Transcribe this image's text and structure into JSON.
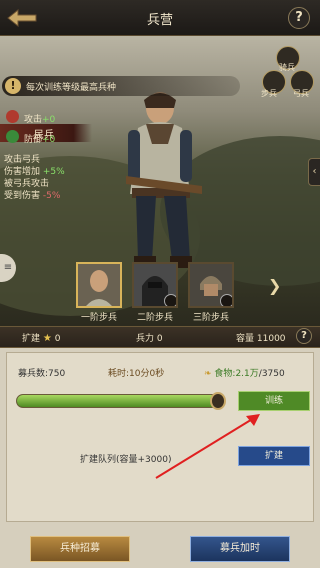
{
  "topbar": {
    "title": "兵营",
    "help": "?"
  },
  "banner": {
    "text": "每次训练等级最高兵种",
    "icon": "upgrade-icon"
  },
  "side": {
    "header": "民兵",
    "attack_label": "攻击",
    "attack_value": "+0",
    "defense_label": "防御",
    "defense_value": "+0",
    "desc": [
      {
        "text": "攻击弓兵",
        "value": ""
      },
      {
        "text": "伤害增加",
        "value": "+5%"
      },
      {
        "text": "被弓兵攻击",
        "value": ""
      },
      {
        "text": "受到伤害",
        "value": "-5%"
      }
    ]
  },
  "skills": {
    "top": "骑兵",
    "left": "步兵",
    "right": "弓兵"
  },
  "units": [
    {
      "label": "一阶步兵",
      "locked": false,
      "selected": true
    },
    {
      "label": "二阶步兵",
      "locked": true,
      "selected": false
    },
    {
      "label": "三阶步兵",
      "locked": true,
      "selected": false
    }
  ],
  "info": {
    "expand_label": "扩建",
    "expand_value": "0",
    "troops_label": "兵力",
    "troops_value": "0",
    "capacity_label": "容量",
    "capacity_value": "11000"
  },
  "panel": {
    "recruit_count": "募兵数:750",
    "time": "耗时:10分0秒",
    "food": "食物:2.1万",
    "food_extra": "/3750",
    "train_label": "训练",
    "expand_queue": "扩建队列(容量+3000)",
    "expand_button": "扩建",
    "progress_fraction": 0.97
  },
  "bottom": {
    "left": "兵种招募",
    "right": "募兵加时"
  },
  "colors": {
    "accent_green": "#4f8a26",
    "accent_blue": "#264a8a",
    "gold": "#d8b45a"
  }
}
